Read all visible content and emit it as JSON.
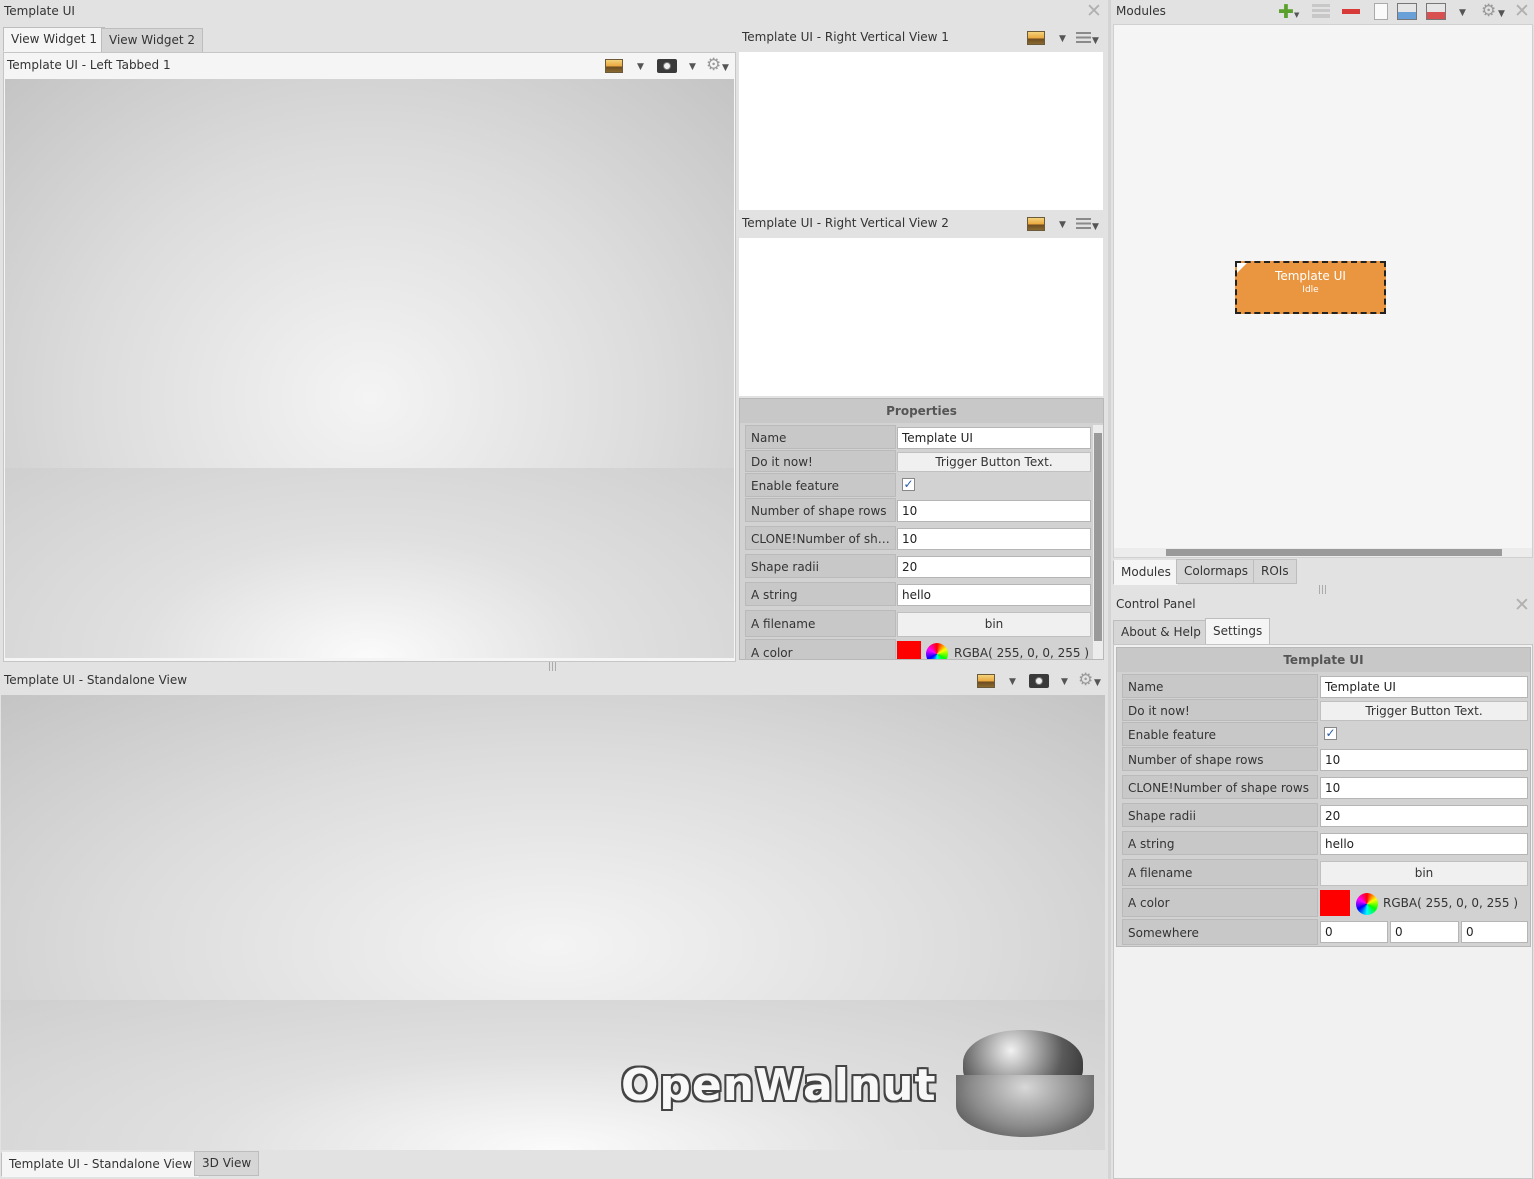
{
  "left_window": {
    "title": "Template UI",
    "tabs": [
      "View Widget 1",
      "View Widget 2"
    ],
    "left_tabbed_title": "Template UI - Left Tabbed 1",
    "right_view1_title": "Template UI - Right Vertical View 1",
    "right_view2_title": "Template UI - Right Vertical View 2",
    "standalone_title": "Template UI - Standalone View",
    "bottom_tabs": [
      "Template UI - Standalone View",
      "3D View"
    ],
    "logo_text": "OpenWalnut"
  },
  "properties": {
    "header": "Properties",
    "rows": [
      {
        "label": "Name",
        "value": "Template UI"
      },
      {
        "label": "Do it now!",
        "value": "Trigger Button Text."
      },
      {
        "label": "Enable feature",
        "value": "✓"
      },
      {
        "label": "Number of shape rows",
        "value": "10"
      },
      {
        "label": "CLONE!Number of sha…",
        "value": "10"
      },
      {
        "label": "Shape radii",
        "value": "20"
      },
      {
        "label": "A string",
        "value": "hello"
      },
      {
        "label": "A filename",
        "value": "bin"
      },
      {
        "label": "A color",
        "value": "RGBA( 255, 0, 0, 255 )"
      }
    ],
    "scroll_position": 0.0
  },
  "modules_panel": {
    "title": "Modules",
    "node": {
      "name": "Template UI",
      "status": "Idle"
    },
    "tabs": [
      "Modules",
      "Colormaps",
      "ROIs"
    ],
    "active_tab": "Modules"
  },
  "control_panel": {
    "title": "Control Panel",
    "tabs": [
      "About & Help",
      "Settings"
    ],
    "active_tab": "Settings",
    "header": "Template UI",
    "rows": [
      {
        "label": "Name",
        "value": "Template UI"
      },
      {
        "label": "Do it now!",
        "value": "Trigger Button Text."
      },
      {
        "label": "Enable feature",
        "value": "✓"
      },
      {
        "label": "Number of shape rows",
        "value": "10"
      },
      {
        "label": "CLONE!Number of shape rows",
        "value": "10"
      },
      {
        "label": "Shape radii",
        "value": "20"
      },
      {
        "label": "A string",
        "value": "hello"
      },
      {
        "label": "A filename",
        "value": "bin"
      },
      {
        "label": "A color",
        "value": "RGBA( 255, 0, 0, 255 )"
      },
      {
        "label": "Somewhere",
        "values": [
          "0",
          "0",
          "0"
        ]
      }
    ]
  },
  "colors": {
    "module_node": "#ea9540",
    "color_swatch": "#ff0000"
  },
  "icons": {
    "close": "close-icon",
    "image": "image-icon",
    "camera": "camera-icon",
    "gear": "gear-icon",
    "menu": "menu-icon",
    "add_module": "add-icon",
    "remove_module": "remove-icon",
    "new_project": "new-file-icon",
    "load": "load-icon",
    "save": "save-icon"
  }
}
